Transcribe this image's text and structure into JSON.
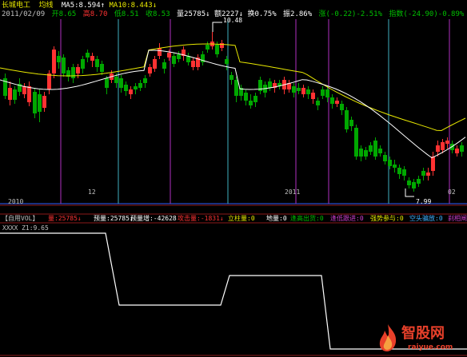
{
  "header": {
    "stock_name": "长城电工",
    "chart_mode": "均线",
    "ma5": "MA5:8.594",
    "ma10": "MA10:8.443",
    "date": "2011/02/09",
    "open": "开8.65",
    "high": "高8.70",
    "low": "低8.51",
    "close": "收8.53",
    "volume": "量25785",
    "amount": "额2227",
    "turnover": "换0.75%",
    "amplitude": "振2.86%",
    "change": "涨(-0.22)-2.51%",
    "index": "指数(-24.90)-0.89%"
  },
  "price_labels": {
    "high_value": "10.48",
    "low_value": "7.99"
  },
  "time_axis": {
    "label_2010": "2010",
    "label_12": "12",
    "label_2011": "2011",
    "label_02": "02"
  },
  "indicator_bar": {
    "name": "【自用VOL】",
    "vol": "量:25785",
    "pred_vol": "预量:25785",
    "pred_inc": "预量增:-42628",
    "attack": "攻击量:-1831",
    "limit_up": "立柱量:0",
    "base": "地量:0",
    "low_cost": "逢高出货:0",
    "pullback": "逢低跟进:0",
    "strong": "强势参与:0",
    "short_bait": "空头骗放:0",
    "kill": "刹相闸"
  },
  "sub_chart": {
    "label": "XXXX Z1:9.65"
  },
  "watermark": {
    "cn": "智股网",
    "url": "raiyue.com"
  },
  "colors": {
    "up": "#ff3232",
    "down": "#00a800",
    "ma5": "#ffffff",
    "ma10": "#e8e800",
    "grid": "#8b1a1a",
    "vline_purple": "#b030c0",
    "vline_cyan": "#40b0c0",
    "blue_line": "#3060ff"
  }
}
